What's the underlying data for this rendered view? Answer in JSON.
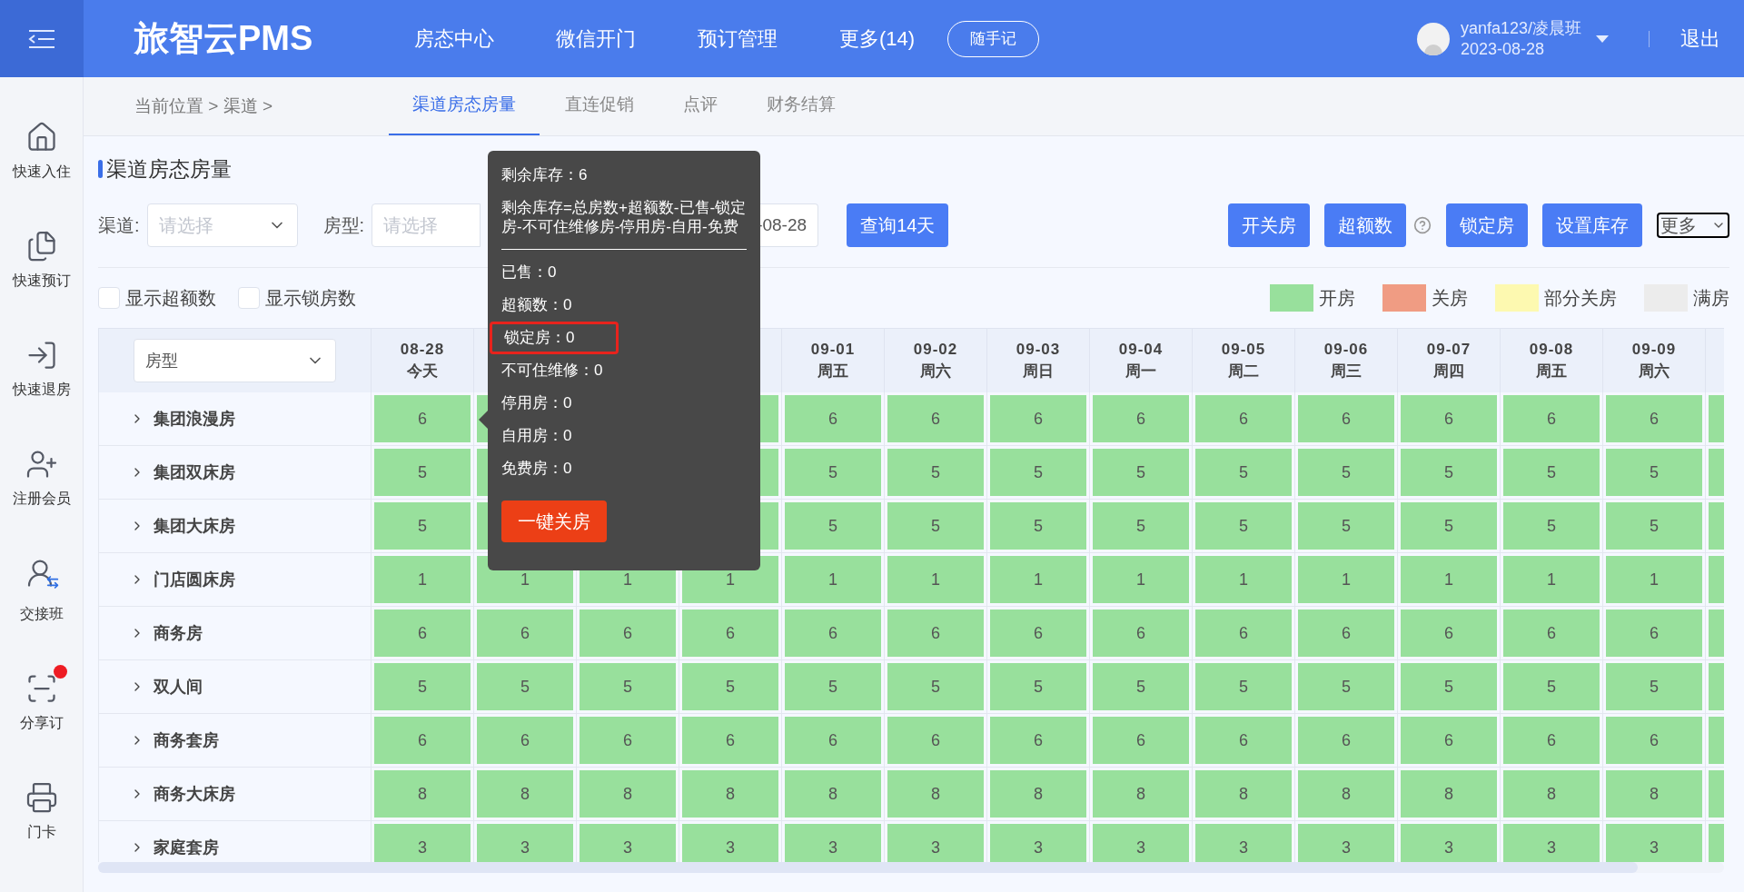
{
  "topbar": {
    "logo": "旅智云PMS",
    "nav": [
      {
        "label": "房态中心"
      },
      {
        "label": "微信开门"
      },
      {
        "label": "预订管理"
      },
      {
        "label": "更多(14)"
      }
    ],
    "note_button": "随手记",
    "user": {
      "name": "yanfa123/凌晨班",
      "date": "2023-08-28"
    },
    "logout": "退出"
  },
  "sidebar": {
    "items": [
      {
        "kind": "checkin",
        "label": "快速入住",
        "badge": false
      },
      {
        "kind": "booking",
        "label": "快速预订",
        "badge": false
      },
      {
        "kind": "checkout",
        "label": "快速退房",
        "badge": false
      },
      {
        "kind": "member",
        "label": "注册会员",
        "badge": false
      },
      {
        "kind": "shift",
        "label": "交接班",
        "badge": false
      },
      {
        "kind": "share",
        "label": "分享订",
        "badge": true
      },
      {
        "kind": "card",
        "label": "门卡",
        "badge": false
      }
    ]
  },
  "breadcrumb": "当前位置 > 渠道 >",
  "tabs": [
    {
      "label": "渠道房态房量",
      "selected": true
    },
    {
      "label": "直连促销",
      "selected": false
    },
    {
      "label": "点评",
      "selected": false
    },
    {
      "label": "财务结算",
      "selected": false
    }
  ],
  "page_title": "渠道房态房量",
  "filters": {
    "channel": {
      "label": "渠道:",
      "placeholder": "请选择"
    },
    "room_type": {
      "label": "房型:",
      "placeholder": "请选择"
    },
    "date": {
      "value": "-08-28"
    },
    "query_button": "查询14天"
  },
  "actions": [
    {
      "label": "开关房",
      "help": false
    },
    {
      "label": "超额数",
      "help": true
    },
    {
      "label": "锁定房",
      "help": false
    },
    {
      "label": "设置库存",
      "help": false
    }
  ],
  "more_select": "更多",
  "checkboxes": [
    {
      "label": "显示超额数",
      "checked": false
    },
    {
      "label": "显示锁房数",
      "checked": false
    }
  ],
  "legend": [
    {
      "kind": "open",
      "label": "开房",
      "color": "#98e09c"
    },
    {
      "kind": "closed",
      "label": "关房",
      "color": "#f09c83"
    },
    {
      "kind": "partial",
      "label": "部分关房",
      "color": "#fdf9b0"
    },
    {
      "kind": "full",
      "label": "满房",
      "color": "#ececec"
    }
  ],
  "table": {
    "room_type_select": "房型",
    "columns": [
      {
        "date": "08-28",
        "weekday": "今天"
      },
      {},
      {},
      {},
      {
        "date": "09-01",
        "weekday": "周五"
      },
      {
        "date": "09-02",
        "weekday": "周六"
      },
      {
        "date": "09-03",
        "weekday": "周日"
      },
      {
        "date": "09-04",
        "weekday": "周一"
      },
      {
        "date": "09-05",
        "weekday": "周二"
      },
      {
        "date": "09-06",
        "weekday": "周三"
      },
      {
        "date": "09-07",
        "weekday": "周四"
      },
      {
        "date": "09-08",
        "weekday": "周五"
      },
      {
        "date": "09-09",
        "weekday": "周六"
      }
    ],
    "rows": [
      {
        "name": "集团浪漫房",
        "kind": "open",
        "cells": [
          "6",
          null,
          null,
          null,
          "6",
          "6",
          "6",
          "6",
          "6",
          "6",
          "6",
          "6",
          "6"
        ]
      },
      {
        "name": "集团双床房",
        "kind": "open",
        "cells": [
          "5",
          null,
          null,
          null,
          "5",
          "5",
          "5",
          "5",
          "5",
          "5",
          "5",
          "5",
          "5"
        ]
      },
      {
        "name": "集团大床房",
        "kind": "open",
        "cells": [
          "5",
          null,
          null,
          null,
          "5",
          "5",
          "5",
          "5",
          "5",
          "5",
          "5",
          "5",
          "5"
        ]
      },
      {
        "name": "门店圆床房",
        "kind": "open",
        "cells": [
          "1",
          "1",
          "1",
          "1",
          "1",
          "1",
          "1",
          "1",
          "1",
          "1",
          "1",
          "1",
          "1"
        ]
      },
      {
        "name": "商务房",
        "kind": "open",
        "cells": [
          "6",
          "6",
          "6",
          "6",
          "6",
          "6",
          "6",
          "6",
          "6",
          "6",
          "6",
          "6",
          "6"
        ]
      },
      {
        "name": "双人间",
        "kind": "open",
        "cells": [
          "5",
          "5",
          "5",
          "5",
          "5",
          "5",
          "5",
          "5",
          "5",
          "5",
          "5",
          "5",
          "5"
        ]
      },
      {
        "name": "商务套房",
        "kind": "open",
        "cells": [
          "6",
          "6",
          "6",
          "6",
          "6",
          "6",
          "6",
          "6",
          "6",
          "6",
          "6",
          "6",
          "6"
        ]
      },
      {
        "name": "商务大床房",
        "kind": "open",
        "cells": [
          "8",
          "8",
          "8",
          "8",
          "8",
          "8",
          "8",
          "8",
          "8",
          "8",
          "8",
          "8",
          "8"
        ]
      },
      {
        "name": "家庭套房",
        "kind": "open",
        "cells": [
          "3",
          "3",
          "3",
          "3",
          "3",
          "3",
          "3",
          "3",
          "3",
          "3",
          "3",
          "3",
          "3"
        ]
      }
    ]
  },
  "tooltip": {
    "remaining": "剩余库存：6",
    "formula": "剩余库存=总房数+超额数-已售-锁定房-不可住维修房-停用房-自用-免费",
    "items": [
      {
        "label": "已售：0",
        "highlighted": false
      },
      {
        "label": "超额数：0",
        "highlighted": false
      },
      {
        "label": "锁定房：0",
        "highlighted": true
      },
      {
        "label": "不可住维修：0",
        "highlighted": false
      },
      {
        "label": "停用房：0",
        "highlighted": false
      },
      {
        "label": "自用房：0",
        "highlighted": false
      },
      {
        "label": "免费房：0",
        "highlighted": false
      }
    ],
    "button": "一键关房"
  }
}
